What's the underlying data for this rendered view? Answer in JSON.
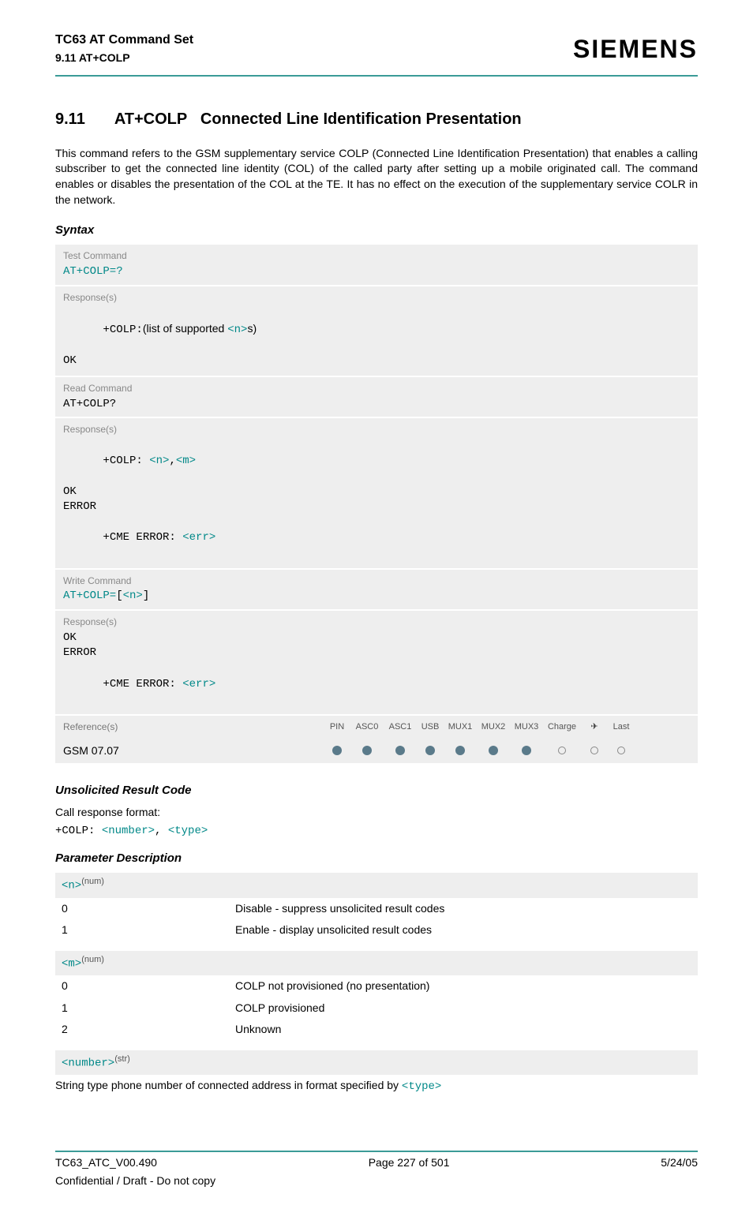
{
  "header": {
    "doc_title": "TC63 AT Command Set",
    "sub_section_ref": "9.11 AT+COLP",
    "brand": "SIEMENS"
  },
  "section": {
    "number": "9.11",
    "cmd": "AT+COLP",
    "title": "Connected Line Identification Presentation",
    "description": "This command refers to the GSM supplementary service COLP (Connected Line Identification Presentation) that enables a calling subscriber to get the connected line identity (COL) of the called party after setting up a mobile originated call. The command enables or disables the presentation of the COL at the TE. It has no effect on the execution of the supplementary service COLR in the network."
  },
  "syntax": {
    "heading": "Syntax",
    "test": {
      "label": "Test Command",
      "command": "AT+COLP=?",
      "resp_label": "Response(s)",
      "resp_prefix": "+COLP:",
      "resp_text_before": "(list of supported ",
      "resp_param": "<n>",
      "resp_text_after": "s)",
      "ok": "OK"
    },
    "read": {
      "label": "Read Command",
      "command": "AT+COLP?",
      "resp_label": "Response(s)",
      "line1_prefix": "+COLP: ",
      "line1_p1": "<n>",
      "line1_sep": ",",
      "line1_p2": "<m>",
      "ok": "OK",
      "error": "ERROR",
      "cme_prefix": "+CME ERROR: ",
      "cme_param": "<err>"
    },
    "write": {
      "label": "Write Command",
      "cmd_prefix": "AT+COLP=",
      "cmd_lb": "[",
      "cmd_param": "<n>",
      "cmd_rb": "]",
      "resp_label": "Response(s)",
      "ok": "OK",
      "error": "ERROR",
      "cme_prefix": "+CME ERROR: ",
      "cme_param": "<err>"
    },
    "reference": {
      "label": "Reference(s)",
      "value": "GSM 07.07",
      "cols": [
        "PIN",
        "ASC0",
        "ASC1",
        "USB",
        "MUX1",
        "MUX2",
        "MUX3",
        "Charge",
        "✈",
        "Last"
      ],
      "states": [
        "f",
        "f",
        "f",
        "f",
        "f",
        "f",
        "f",
        "e",
        "e",
        "e"
      ]
    }
  },
  "urc": {
    "heading": "Unsolicited Result Code",
    "desc": "Call response format:",
    "prefix": "+COLP: ",
    "p1": "<number>",
    "sep": ", ",
    "p2": "<type>"
  },
  "params": {
    "heading": "Parameter Description",
    "n": {
      "name": "<n>",
      "sup": "(num)",
      "rows": [
        {
          "k": "0",
          "v": "Disable - suppress unsolicited result codes"
        },
        {
          "k": "1",
          "v": "Enable - display unsolicited result codes"
        }
      ]
    },
    "m": {
      "name": "<m>",
      "sup": "(num)",
      "rows": [
        {
          "k": "0",
          "v": "COLP not provisioned (no presentation)"
        },
        {
          "k": "1",
          "v": "COLP provisioned"
        },
        {
          "k": "2",
          "v": "Unknown"
        }
      ]
    },
    "number": {
      "name": "<number>",
      "sup": "(str)"
    },
    "number_desc_pre": "String type phone number of connected address in format specified by ",
    "number_desc_tok": "<type>"
  },
  "footer": {
    "left": "TC63_ATC_V00.490",
    "center": "Page 227 of 501",
    "right": "5/24/05",
    "sub": "Confidential / Draft - Do not copy"
  }
}
